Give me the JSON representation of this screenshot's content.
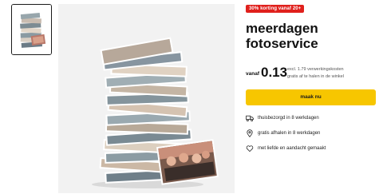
{
  "promo": {
    "badge": "30% korting vanaf 20+"
  },
  "product": {
    "title": "meerdagen fotoservice"
  },
  "price": {
    "prefix": "vanaf",
    "amount": "0.13",
    "note_line1": "excl. 1.79 verwerkingskosten",
    "note_line2": "gratis af te halen in de winkel"
  },
  "cta": {
    "label": "maak nu"
  },
  "features": [
    {
      "icon": "truck-icon",
      "text": "thuisbezorgd in 8 werkdagen"
    },
    {
      "icon": "location-pin-icon",
      "text": "gratis afhalen in 8 werkdagen"
    },
    {
      "icon": "heart-icon",
      "text": "met liefde en aandacht gemaakt"
    }
  ],
  "colors": {
    "badge": "#e0201c",
    "cta": "#f7c600",
    "panel": "#f2f2f2"
  }
}
